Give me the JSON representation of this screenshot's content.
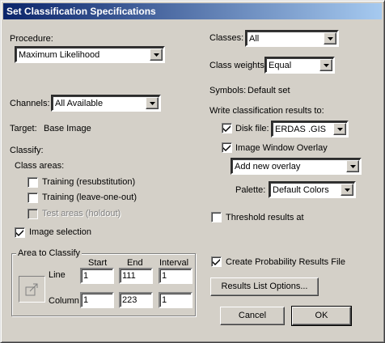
{
  "window": {
    "title": "Set Classification Specifications"
  },
  "left": {
    "procedure_label": "Procedure:",
    "procedure_value": "Maximum Likelihood",
    "channels_label": "Channels:",
    "channels_value": "All Available",
    "target_label": "Target:",
    "target_value": "Base Image",
    "classify_label": "Classify:",
    "class_areas_label": "Class areas:",
    "training_resub": "Training (resubstitution)",
    "training_loo": "Training (leave-one-out)",
    "test_areas": "Test areas (holdout)",
    "image_selection": "Image selection",
    "area_to_classify": "Area to Classify",
    "col_start": "Start",
    "col_end": "End",
    "col_interval": "Interval",
    "line_label": "Line",
    "column_label": "Column",
    "line_start": "1",
    "line_end": "111",
    "line_interval": "1",
    "column_start": "1",
    "column_end": "223",
    "column_interval": "1"
  },
  "right": {
    "classes_label": "Classes:",
    "classes_value": "All",
    "class_weights_label": "Class weights:",
    "class_weights_value": "Equal",
    "symbols_label": "Symbols:",
    "symbols_value": "Default set",
    "write_results_label": "Write classification results to:",
    "disk_file_label": "Disk file:",
    "disk_file_value": "ERDAS .GIS",
    "image_window_overlay": "Image Window Overlay",
    "overlay_value": "Add new overlay",
    "palette_label": "Palette:",
    "palette_value": "Default Colors",
    "threshold_label": "Threshold results at",
    "create_prob_label": "Create Probability Results File",
    "results_list_button": "Results List Options...",
    "cancel_button": "Cancel",
    "ok_button": "OK"
  },
  "state": {
    "training_resub": false,
    "training_loo": false,
    "test_areas": false,
    "image_selection": true,
    "disk_file": true,
    "image_window_overlay": true,
    "threshold": false,
    "create_prob": true
  }
}
